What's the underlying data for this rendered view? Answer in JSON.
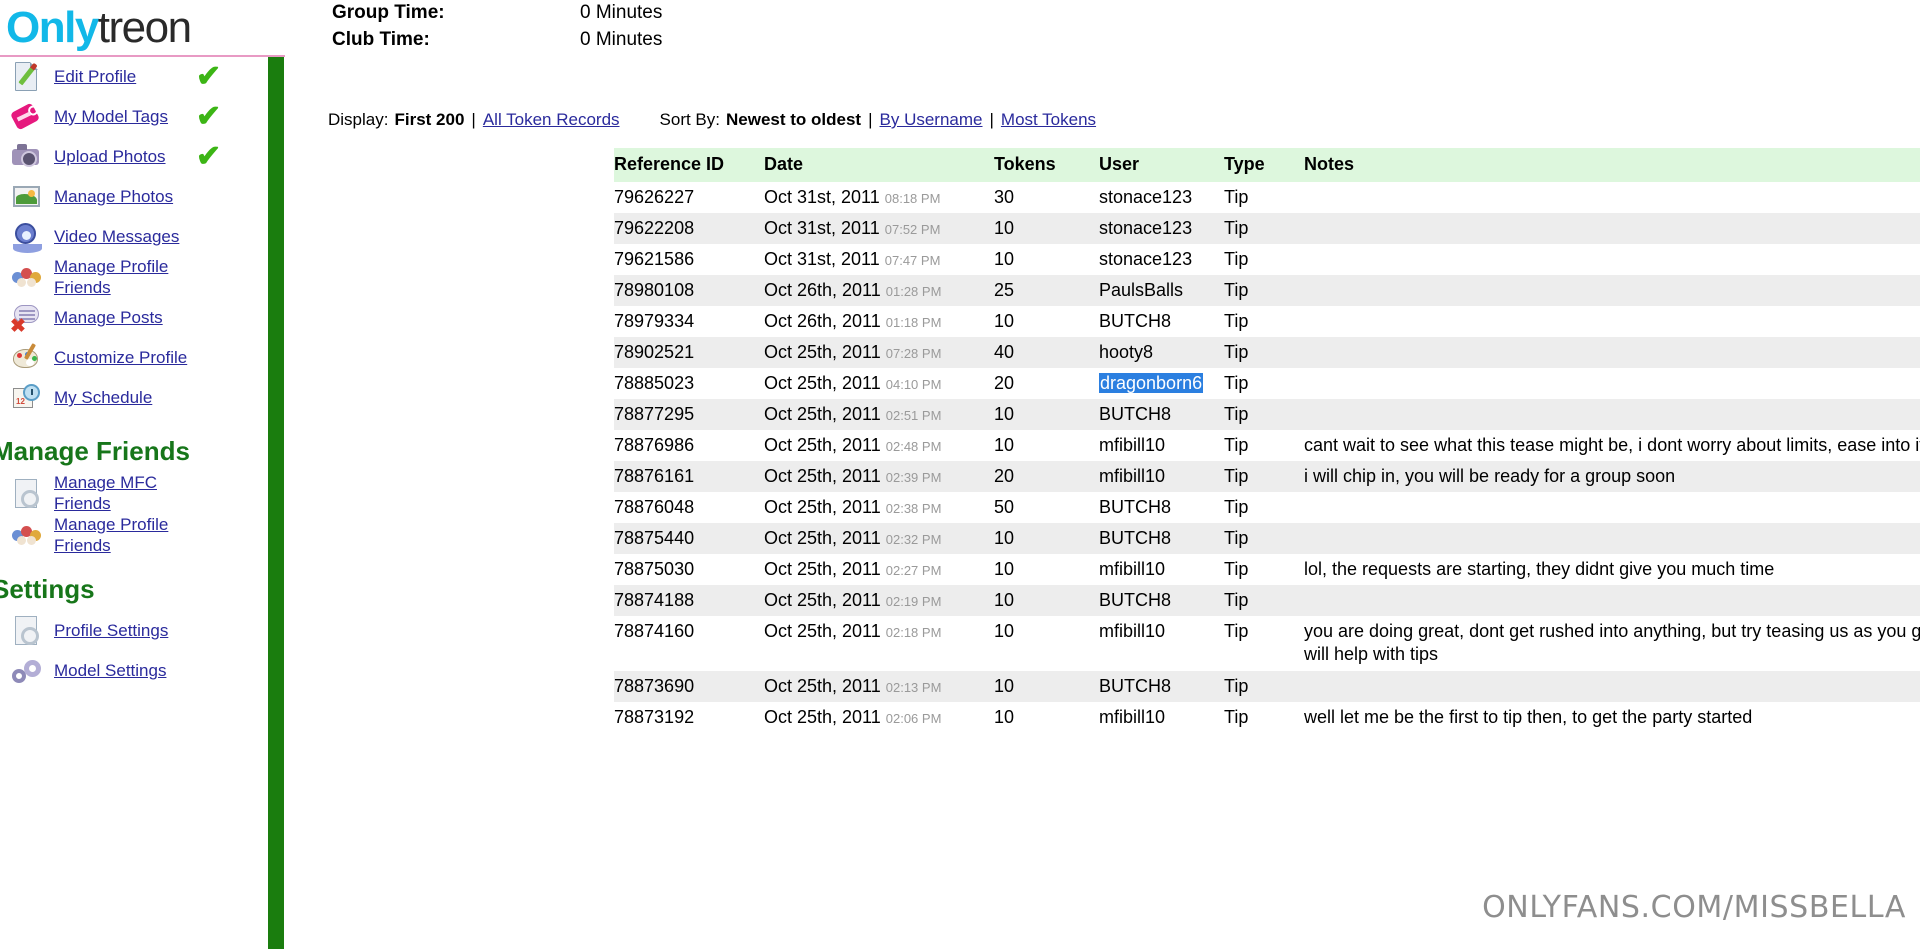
{
  "brand": {
    "part1": "Only",
    "part2": "treon"
  },
  "sidebar": {
    "items": [
      {
        "label": "Edit Profile",
        "icon": "document-edit-icon",
        "check": "✔"
      },
      {
        "label": "My Model Tags",
        "icon": "tag-icon",
        "check": "✔"
      },
      {
        "label": "Upload Photos",
        "icon": "camera-icon",
        "check": "✔"
      },
      {
        "label": "Manage Photos",
        "icon": "picture-icon",
        "check": ""
      },
      {
        "label": "Video Messages",
        "icon": "webcam-icon",
        "check": ""
      },
      {
        "label": "Manage Profile Friends",
        "icon": "people-icon",
        "check": ""
      },
      {
        "label": "Manage Posts",
        "icon": "post-bubble-icon",
        "check": ""
      },
      {
        "label": "Customize Profile",
        "icon": "palette-icon",
        "check": ""
      },
      {
        "label": "My Schedule",
        "icon": "calendar-clock-icon",
        "check": ""
      }
    ],
    "section_manage_friends": "Manage Friends",
    "friends_items": [
      {
        "label": "Manage MFC Friends",
        "icon": "gear-page-icon"
      },
      {
        "label": "Manage Profile Friends",
        "icon": "people-icon"
      }
    ],
    "section_settings": "Settings",
    "settings_items": [
      {
        "label": "Profile Settings",
        "icon": "gear-page-icon"
      },
      {
        "label": "Model Settings",
        "icon": "gears-icon"
      }
    ]
  },
  "header": {
    "group_time_label": "Group Time:",
    "group_time_value": "0 Minutes",
    "club_time_label": "Club Time:",
    "club_time_value": "0 Minutes"
  },
  "controls": {
    "display_label": "Display:",
    "display_current": "First 200",
    "display_alt": "All Token Records",
    "sort_label": "Sort By:",
    "sort_current": "Newest to oldest",
    "sort_alt_1": "By Username",
    "sort_alt_2": "Most Tokens",
    "separator": "|"
  },
  "table": {
    "columns": [
      "Reference ID",
      "Date",
      "Tokens",
      "User",
      "Type",
      "Notes"
    ],
    "rows": [
      {
        "ref": "79626227",
        "date": "Oct 31st, 2011",
        "time": "08:18 PM",
        "tokens": "30",
        "user": "stonace123",
        "type": "Tip",
        "notes": "",
        "selected": false
      },
      {
        "ref": "79622208",
        "date": "Oct 31st, 2011",
        "time": "07:52 PM",
        "tokens": "10",
        "user": "stonace123",
        "type": "Tip",
        "notes": "",
        "selected": false
      },
      {
        "ref": "79621586",
        "date": "Oct 31st, 2011",
        "time": "07:47 PM",
        "tokens": "10",
        "user": "stonace123",
        "type": "Tip",
        "notes": "",
        "selected": false
      },
      {
        "ref": "78980108",
        "date": "Oct 26th, 2011",
        "time": "01:28 PM",
        "tokens": "25",
        "user": "PaulsBalls",
        "type": "Tip",
        "notes": "",
        "selected": false
      },
      {
        "ref": "78979334",
        "date": "Oct 26th, 2011",
        "time": "01:18 PM",
        "tokens": "10",
        "user": "BUTCH8",
        "type": "Tip",
        "notes": "",
        "selected": false
      },
      {
        "ref": "78902521",
        "date": "Oct 25th, 2011",
        "time": "07:28 PM",
        "tokens": "40",
        "user": "hooty8",
        "type": "Tip",
        "notes": "",
        "selected": false
      },
      {
        "ref": "78885023",
        "date": "Oct 25th, 2011",
        "time": "04:10 PM",
        "tokens": "20",
        "user": "dragonborn6",
        "type": "Tip",
        "notes": "",
        "selected": true
      },
      {
        "ref": "78877295",
        "date": "Oct 25th, 2011",
        "time": "02:51 PM",
        "tokens": "10",
        "user": "BUTCH8",
        "type": "Tip",
        "notes": "",
        "selected": false
      },
      {
        "ref": "78876986",
        "date": "Oct 25th, 2011",
        "time": "02:48 PM",
        "tokens": "10",
        "user": "mfibill10",
        "type": "Tip",
        "notes": "cant wait to see what this tease might be, i dont worry about limits, ease into it slowly",
        "selected": false
      },
      {
        "ref": "78876161",
        "date": "Oct 25th, 2011",
        "time": "02:39 PM",
        "tokens": "20",
        "user": "mfibill10",
        "type": "Tip",
        "notes": "i will chip in, you will be ready for a group soon",
        "selected": false
      },
      {
        "ref": "78876048",
        "date": "Oct 25th, 2011",
        "time": "02:38 PM",
        "tokens": "50",
        "user": "BUTCH8",
        "type": "Tip",
        "notes": "",
        "selected": false
      },
      {
        "ref": "78875440",
        "date": "Oct 25th, 2011",
        "time": "02:32 PM",
        "tokens": "10",
        "user": "BUTCH8",
        "type": "Tip",
        "notes": "",
        "selected": false
      },
      {
        "ref": "78875030",
        "date": "Oct 25th, 2011",
        "time": "02:27 PM",
        "tokens": "10",
        "user": "mfibill10",
        "type": "Tip",
        "notes": "lol, the requests are starting, they didnt give you much time",
        "selected": false
      },
      {
        "ref": "78874188",
        "date": "Oct 25th, 2011",
        "time": "02:19 PM",
        "tokens": "10",
        "user": "BUTCH8",
        "type": "Tip",
        "notes": "",
        "selected": false
      },
      {
        "ref": "78874160",
        "date": "Oct 25th, 2011",
        "time": "02:18 PM",
        "tokens": "10",
        "user": "mfibill10",
        "type": "Tip",
        "notes": "you are doing great, dont get rushed into anything, but try teasing us as you get more comfortable, it will help with tips",
        "selected": false
      },
      {
        "ref": "78873690",
        "date": "Oct 25th, 2011",
        "time": "02:13 PM",
        "tokens": "10",
        "user": "BUTCH8",
        "type": "Tip",
        "notes": "",
        "selected": false
      },
      {
        "ref": "78873192",
        "date": "Oct 25th, 2011",
        "time": "02:06 PM",
        "tokens": "10",
        "user": "mfibill10",
        "type": "Tip",
        "notes": "well let me be the first to tip then, to get the party started",
        "selected": false
      }
    ]
  },
  "watermark": "ONLYFANS.COM/MISSBELLA",
  "colors": {
    "brand_blue": "#12b8e8",
    "green_bar": "#1a7d0e",
    "section_green": "#17761a",
    "link_blue": "#2a2a9c",
    "header_bg": "#ddf7dd",
    "row_alt": "#ededed",
    "selection_blue": "#2b7fe0",
    "check_green": "#3cb515"
  }
}
